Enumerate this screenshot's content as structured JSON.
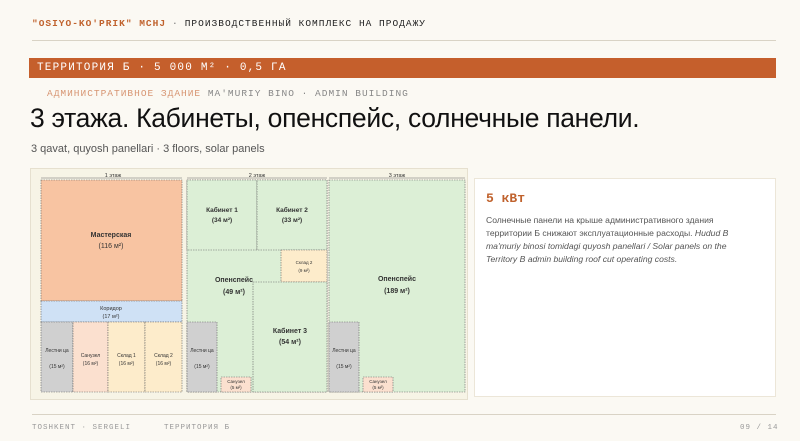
{
  "header": {
    "org": "\"OSIYO-KO'PRIK\" MCHJ",
    "separator": "·",
    "title": "ПРОИЗВОДСТВЕННЫЙ КОМПЛЕКС НА ПРОДАЖУ"
  },
  "band": {
    "text": "ТЕРРИТОРИЯ Б · 5 000 М² · 0,5 ГА"
  },
  "eyebrow": {
    "ru": "АДМИНИСТРАТИВНОЕ ЗДАНИЕ",
    "latin": "MA'MURIY BINO · ADMIN BUILDING"
  },
  "heading": "3 этажа. Кабинеты, опенспейс, солнечные панели.",
  "subheading": "3 qavat, quyosh panellari · 3 floors, solar panels",
  "floorplan": {
    "floors": [
      {
        "label": "1 этаж",
        "rooms": [
          {
            "name": "Мастерская",
            "area": "(116 м²)"
          },
          {
            "name": "Коридор",
            "area": "(17 м²)"
          },
          {
            "name": "Лестни ца",
            "area": "(15 м²)"
          },
          {
            "name": "Санузел",
            "area": "(16 м²)"
          },
          {
            "name": "Склад 1",
            "area": "(16 м²)"
          },
          {
            "name": "Склад 2",
            "area": "(16 м²)"
          }
        ]
      },
      {
        "label": "2 этаж",
        "rooms": [
          {
            "name": "Кабинет 1",
            "area": "(34 м²)"
          },
          {
            "name": "Кабинет 2",
            "area": "(33 м²)"
          },
          {
            "name": "Склад 2",
            "area": "(9 м²)"
          },
          {
            "name": "Опенспейс",
            "area": "(49 м²)"
          },
          {
            "name": "Кабинет 3",
            "area": "(54 м²)"
          },
          {
            "name": "Лестни ца",
            "area": "(15 м²)"
          },
          {
            "name": "Санузел",
            "area": "(5 м²)"
          }
        ]
      },
      {
        "label": "3 этаж",
        "rooms": [
          {
            "name": "Опенспейс",
            "area": "(189 м²)"
          },
          {
            "name": "Лестни ца",
            "area": "(15 м²)"
          },
          {
            "name": "Санузел",
            "area": "(5 м²)"
          }
        ]
      }
    ]
  },
  "info": {
    "title": "5 кВт",
    "text_ru": "Солнечные панели на крыше административного здания территории Б снижают эксплуатационные расходы.",
    "text_alt": "Hudud B ma'muriy binosi tomidagi quyosh panellari / Solar panels on the Territory B admin building roof cut operating costs."
  },
  "footer": {
    "left": "TOSHKENT · SERGELI      ТЕРРИТОРИЯ Б",
    "page": "09 / 14"
  },
  "colors": {
    "accent": "#c55f2c",
    "workshop": "#f8c4a2",
    "corridor": "#cfe1f5",
    "stair": "#d0d0d0",
    "sanitary": "#fbe0cf",
    "storage": "#fdeccb",
    "office": "#dcefd6"
  }
}
